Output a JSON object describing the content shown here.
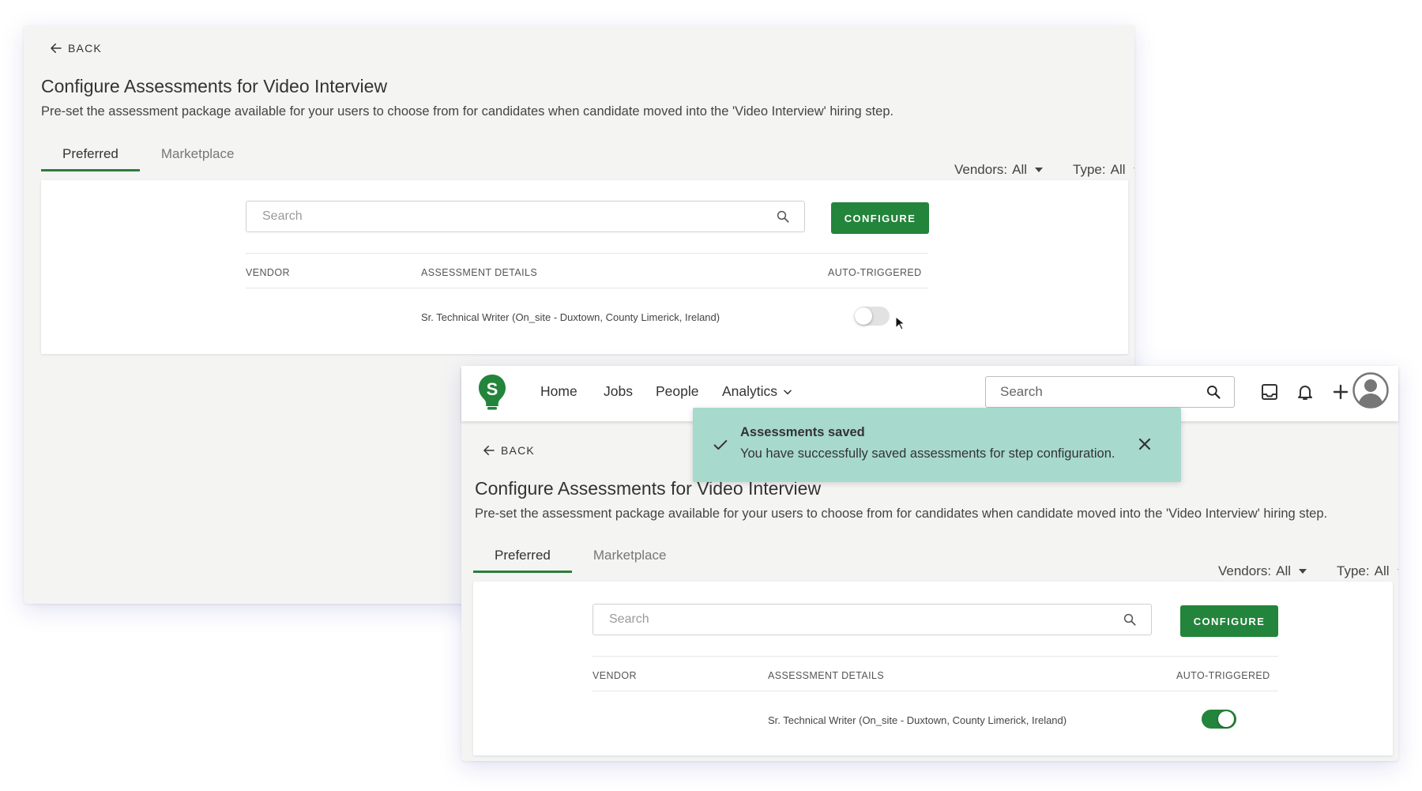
{
  "back_screen": {
    "back_label": "BACK",
    "title": "Configure Assessments for Video Interview",
    "description": "Pre-set the assessment package available for your users to choose from for candidates when candidate moved into the 'Video Interview' hiring step.",
    "tabs": [
      {
        "label": "Preferred",
        "active": true
      },
      {
        "label": "Marketplace",
        "active": false
      }
    ],
    "filters": {
      "vendors_label": "Vendors:",
      "vendors_value": "All",
      "type_label": "Type:",
      "type_value": "All"
    },
    "search_placeholder": "Search",
    "configure_label": "CONFIGURE",
    "columns": [
      "VENDOR",
      "ASSESSMENT DETAILS",
      "AUTO-TRIGGERED"
    ],
    "row": {
      "vendor": "",
      "details": "Sr. Technical Writer (On_site - Duxtown, County Limerick, Ireland)",
      "auto_triggered": false
    }
  },
  "front_screen": {
    "nav": {
      "items": [
        "Home",
        "Jobs",
        "People",
        "Analytics"
      ],
      "search_placeholder": "Search"
    },
    "toast": {
      "title": "Assessments saved",
      "message": "You have successfully saved assessments for step configuration."
    },
    "back_label": "BACK",
    "title": "Configure Assessments for Video Interview",
    "description": "Pre-set the assessment package available for your users to choose from for candidates when candidate moved into the 'Video Interview' hiring step.",
    "tabs": [
      {
        "label": "Preferred",
        "active": true
      },
      {
        "label": "Marketplace",
        "active": false
      }
    ],
    "filters": {
      "vendors_label": "Vendors:",
      "vendors_value": "All",
      "type_label": "Type:",
      "type_value": "All"
    },
    "search_placeholder": "Search",
    "configure_label": "CONFIGURE",
    "columns": [
      "VENDOR",
      "ASSESSMENT DETAILS",
      "AUTO-TRIGGERED"
    ],
    "row": {
      "vendor": "",
      "details": "Sr. Technical Writer (On_site - Duxtown, County Limerick, Ireland)",
      "auto_triggered": true
    }
  },
  "colors": {
    "brand_green": "#23843b",
    "toast_bg": "#a7d9cd",
    "page_bg": "#f4f4f3"
  }
}
